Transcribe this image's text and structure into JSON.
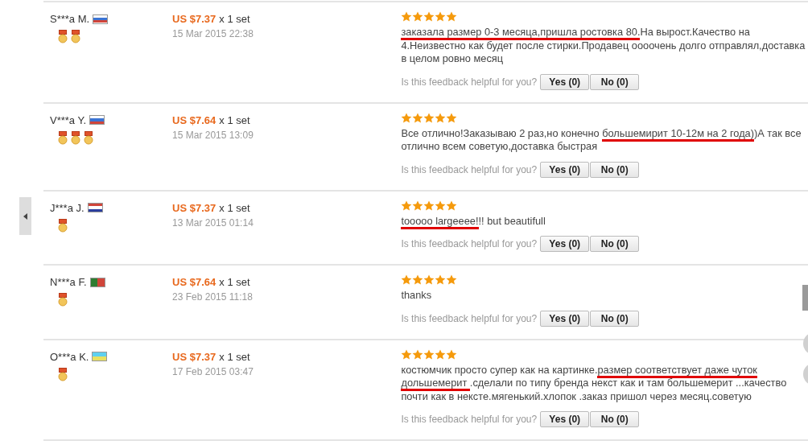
{
  "reviews": [
    {
      "buyer": "S***a M.",
      "flag": {
        "kind": "horizontal",
        "stripes": [
          {
            "color": "#ffffff"
          },
          {
            "color": "#3b74d4"
          },
          {
            "color": "#d0453a"
          }
        ]
      },
      "badges": [
        {
          "kind": "medal"
        },
        {
          "kind": "medal"
        }
      ],
      "price": "US $7.37",
      "quantity": "x 1 set",
      "date": "15 Mar 2015 22:38",
      "stars": 5,
      "text": [
        {
          "text": "заказала размер 0-3 месяца,пришла ростовка 80.",
          "underlined": true
        },
        {
          "text": "На вырост.Качество на 4.Неизвестно как будет после стирки.Продавец оооочень долго отправлял,доставка в целом ровно месяц",
          "underlined": false
        }
      ],
      "helpful_prompt": "Is this feedback helpful for you?",
      "yes_button": "Yes (0)",
      "no_button": "No (0)"
    },
    {
      "buyer": "V***a Y.",
      "flag": {
        "kind": "horizontal",
        "stripes": [
          {
            "color": "#ffffff"
          },
          {
            "color": "#3b74d4"
          },
          {
            "color": "#d0453a"
          }
        ]
      },
      "badges": [
        {
          "kind": "medal"
        },
        {
          "kind": "medal"
        },
        {
          "kind": "medal"
        }
      ],
      "price": "US $7.64",
      "quantity": "x 1 set",
      "date": "15 Mar 2015 13:09",
      "stars": 5,
      "text": [
        {
          "text": "Все отлично!Заказываю 2 раз,но конечно ",
          "underlined": false
        },
        {
          "text": "большемирит 10-12м на 2 года)",
          "underlined": true
        },
        {
          "text": ")А так все отлично всем советую,доставка быстрая",
          "underlined": false
        }
      ],
      "helpful_prompt": "Is this feedback helpful for you?",
      "yes_button": "Yes (0)",
      "no_button": "No (0)"
    },
    {
      "buyer": "J***a J.",
      "flag": {
        "kind": "horizontal",
        "stripes": [
          {
            "color": "#d0453a"
          },
          {
            "color": "#ffffff"
          },
          {
            "color": "#2b3f9e"
          }
        ]
      },
      "badges": [
        {
          "kind": "medal"
        }
      ],
      "price": "US $7.37",
      "quantity": "x 1 set",
      "date": "13 Mar 2015 01:14",
      "stars": 5,
      "text": [
        {
          "text": "tooooo largeeee!",
          "underlined": true
        },
        {
          "text": "!! but beautifull",
          "underlined": false
        }
      ],
      "helpful_prompt": "Is this feedback helpful for you?",
      "yes_button": "Yes (0)",
      "no_button": "No (0)"
    },
    {
      "buyer": "N***a F.",
      "flag": {
        "kind": "vertical",
        "stripes": [
          {
            "color": "#2e7d32"
          },
          {
            "color": "#d0453a"
          }
        ]
      },
      "badges": [
        {
          "kind": "medal"
        }
      ],
      "price": "US $7.64",
      "quantity": "x 1 set",
      "date": "23 Feb 2015 11:18",
      "stars": 5,
      "text": [
        {
          "text": "thanks",
          "underlined": false
        }
      ],
      "helpful_prompt": "Is this feedback helpful for you?",
      "yes_button": "Yes (0)",
      "no_button": "No (0)"
    },
    {
      "buyer": "O***a K.",
      "flag": {
        "kind": "horizontal",
        "stripes": [
          {
            "color": "#5ed0f0"
          },
          {
            "color": "#e8e060"
          }
        ]
      },
      "badges": [
        {
          "kind": "medal"
        }
      ],
      "price": "US $7.37",
      "quantity": "x 1 set",
      "date": "17 Feb 2015 03:47",
      "stars": 5,
      "text": [
        {
          "text": "костюмчик просто супер как на картинке.",
          "underlined": false
        },
        {
          "text": "размер соответствует даже чуток дольшемерит ",
          "underlined": true
        },
        {
          "text": ".сделали по типу бренда некст как и там большемерит ...качество почти как в нексте.мягенький.хлопок .заказ пришол через месяц.советую",
          "underlined": false
        }
      ],
      "helpful_prompt": "Is this feedback helpful for you?",
      "yes_button": "Yes (0)",
      "no_button": "No (0)"
    }
  ]
}
